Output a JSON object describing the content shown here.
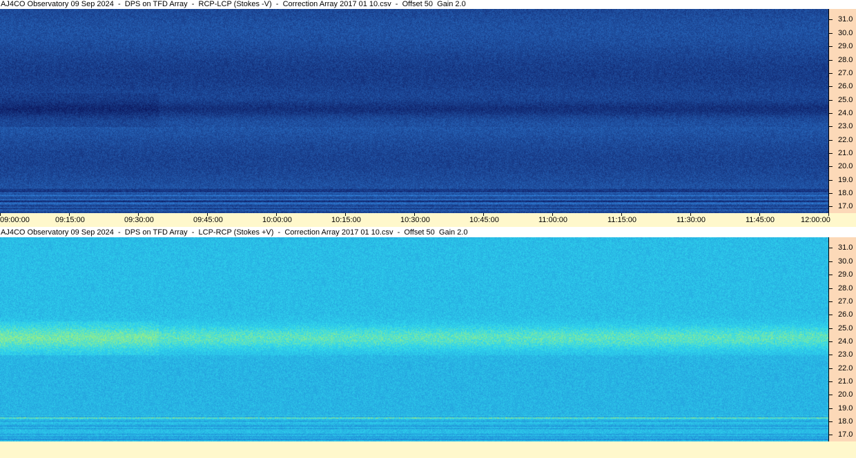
{
  "panels": [
    {
      "title": "AJ4CO Observatory 09 Sep 2024  -  DPS on TFD Array  -  RCP-LCP (Stokes -V)  -  Correction Array 2017 01 10.csv  -  Offset 50  Gain 2.0",
      "palette": "dark"
    },
    {
      "title": "AJ4CO Observatory 09 Sep 2024  -  DPS on TFD Array  -  LCP-RCP (Stokes +V)  -  Correction Array 2017 01 10.csv  -  Offset 50  Gain 2.0",
      "palette": "light"
    }
  ],
  "y_axis": {
    "unit": "MHz",
    "range": [
      16.5,
      31.8
    ],
    "labels": [
      "31.0",
      "30.0",
      "29.0",
      "28.0",
      "27.0",
      "26.0",
      "25.0",
      "24.0",
      "23.0",
      "22.0",
      "21.0",
      "20.0",
      "19.0",
      "18.0",
      "17.0"
    ]
  },
  "x_axis": {
    "labels": [
      "09:00:00",
      "09:15:00",
      "09:30:00",
      "09:45:00",
      "10:00:00",
      "10:15:00",
      "10:30:00",
      "10:45:00",
      "11:00:00",
      "11:15:00",
      "11:30:00",
      "11:45:00",
      "12:00:00"
    ]
  },
  "colors": {
    "axis_bg": "#fcd9b8",
    "time_bg": "#fff8cc",
    "dark_base": "#1f45c8",
    "light_base": "#2a8fe8"
  }
}
